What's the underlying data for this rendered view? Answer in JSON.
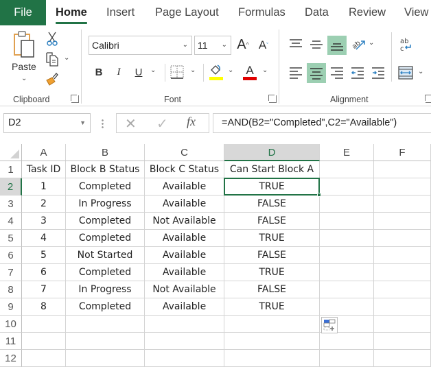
{
  "tabs": [
    {
      "label": "File"
    },
    {
      "label": "Home",
      "active": true
    },
    {
      "label": "Insert"
    },
    {
      "label": "Page Layout"
    },
    {
      "label": "Formulas"
    },
    {
      "label": "Data"
    },
    {
      "label": "Review"
    },
    {
      "label": "View"
    }
  ],
  "ribbon": {
    "clipboard": {
      "group_label": "Clipboard",
      "paste_label": "Paste",
      "icons": [
        "paste-icon",
        "cut-icon",
        "copy-icon",
        "format-painter-icon"
      ]
    },
    "font": {
      "group_label": "Font",
      "font_name": "Calibri",
      "font_size": "11",
      "bold_label": "B",
      "italic_label": "I",
      "underline_label": "U",
      "grow_label": "A",
      "shrink_label": "A",
      "font_color_label": "A",
      "highlight_color": "#ffff00",
      "font_color": "#e00000"
    },
    "alignment": {
      "group_label": "Alignment",
      "active_vertical": "bottom-align",
      "active_horizontal": "center"
    }
  },
  "formula_bar": {
    "name_box": "D2",
    "formula": "=AND(B2=\"Completed\",C2=\"Available\")",
    "cancel_icon": "x-icon",
    "enter_icon": "check-icon",
    "fx_label": "fx"
  },
  "sheet": {
    "columns": [
      "A",
      "B",
      "C",
      "D",
      "E",
      "F"
    ],
    "selected_column": "D",
    "selected_row": 2,
    "row_numbers": [
      "1",
      "2",
      "3",
      "4",
      "5",
      "6",
      "7",
      "8",
      "9",
      "10",
      "11",
      "12"
    ],
    "header_row": [
      "Task ID",
      "Block B Status",
      "Block C Status",
      "Can Start Block A"
    ],
    "rows": [
      [
        "1",
        "Completed",
        "Available",
        "TRUE"
      ],
      [
        "2",
        "In Progress",
        "Available",
        "FALSE"
      ],
      [
        "3",
        "Completed",
        "Not Available",
        "FALSE"
      ],
      [
        "4",
        "Completed",
        "Available",
        "TRUE"
      ],
      [
        "5",
        "Not Started",
        "Available",
        "FALSE"
      ],
      [
        "6",
        "Completed",
        "Available",
        "TRUE"
      ],
      [
        "7",
        "In Progress",
        "Not Available",
        "FALSE"
      ],
      [
        "8",
        "Completed",
        "Available",
        "TRUE"
      ]
    ]
  },
  "colors": {
    "accent": "#217346",
    "selected_header_bg": "#d8d8d8",
    "active_toggle_bg": "#9ccfb2"
  }
}
